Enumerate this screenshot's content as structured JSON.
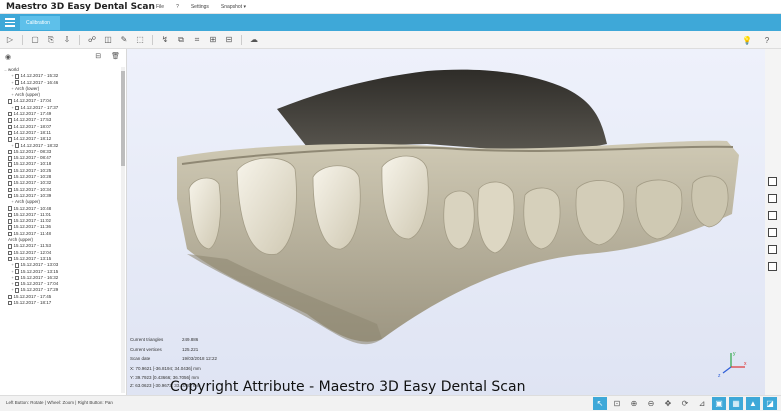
{
  "app": {
    "title": "Maestro 3D Easy Dental Scan"
  },
  "menu": [
    "File",
    "?",
    "Settings",
    "Snapshot"
  ],
  "tab": {
    "label": "Calibration"
  },
  "sidebar": {
    "items": [
      {
        "label": "world",
        "level": 0,
        "exp": "–",
        "doc": false
      },
      {
        "label": "14.12.2017 - 15:32",
        "level": 1,
        "exp": "+",
        "doc": true
      },
      {
        "label": "14.12.2017 - 16:46",
        "level": 1,
        "exp": "+",
        "doc": true
      },
      {
        "label": "Arch (lower)",
        "level": 1,
        "exp": "+",
        "doc": false
      },
      {
        "label": "Arch (upper)",
        "level": 1,
        "exp": "+",
        "doc": false
      },
      {
        "label": "14.12.2017 - 17:04",
        "level": 0,
        "exp": "",
        "doc": true
      },
      {
        "label": "14.12.2017 - 17:37",
        "level": 1,
        "exp": "+",
        "doc": true
      },
      {
        "label": "14.12.2017 - 17:49",
        "level": 0,
        "exp": "",
        "doc": true
      },
      {
        "label": "14.12.2017 - 17:53",
        "level": 0,
        "exp": "",
        "doc": true
      },
      {
        "label": "14.12.2017 - 18:07",
        "level": 0,
        "exp": "",
        "doc": true
      },
      {
        "label": "14.12.2017 - 18:11",
        "level": 0,
        "exp": "",
        "doc": true
      },
      {
        "label": "14.12.2017 - 18:12",
        "level": 0,
        "exp": "",
        "doc": true
      },
      {
        "label": "14.12.2017 - 18:32",
        "level": 1,
        "exp": "+",
        "doc": true
      },
      {
        "label": "15.12.2017 - 08:33",
        "level": 0,
        "exp": "",
        "doc": true
      },
      {
        "label": "15.12.2017 - 08:47",
        "level": 0,
        "exp": "",
        "doc": true
      },
      {
        "label": "15.12.2017 - 10:18",
        "level": 0,
        "exp": "",
        "doc": true
      },
      {
        "label": "15.12.2017 - 10:25",
        "level": 0,
        "exp": "",
        "doc": true
      },
      {
        "label": "15.12.2017 - 10:28",
        "level": 0,
        "exp": "",
        "doc": true
      },
      {
        "label": "15.12.2017 - 10:32",
        "level": 0,
        "exp": "",
        "doc": true
      },
      {
        "label": "15.12.2017 - 10:34",
        "level": 0,
        "exp": "",
        "doc": true
      },
      {
        "label": "15.12.2017 - 10:39",
        "level": 0,
        "exp": "",
        "doc": true
      },
      {
        "label": "Arch (upper)",
        "level": 1,
        "exp": "+",
        "doc": false
      },
      {
        "label": "15.12.2017 - 10:48",
        "level": 0,
        "exp": "",
        "doc": true
      },
      {
        "label": "15.12.2017 - 11:01",
        "level": 0,
        "exp": "",
        "doc": true
      },
      {
        "label": "15.12.2017 - 11:02",
        "level": 0,
        "exp": "",
        "doc": true
      },
      {
        "label": "15.12.2017 - 11:36",
        "level": 0,
        "exp": "",
        "doc": true
      },
      {
        "label": "15.12.2017 - 11:48",
        "level": 0,
        "exp": "",
        "doc": true
      },
      {
        "label": "Arch (upper)",
        "level": 0,
        "exp": "",
        "doc": false
      },
      {
        "label": "15.12.2017 - 11:53",
        "level": 0,
        "exp": "",
        "doc": true
      },
      {
        "label": "15.12.2017 - 12:04",
        "level": 0,
        "exp": "",
        "doc": true
      },
      {
        "label": "15.12.2017 - 13:15",
        "level": 0,
        "exp": "",
        "doc": true
      },
      {
        "label": "15.12.2017 - 13:03",
        "level": 1,
        "exp": "+",
        "doc": true
      },
      {
        "label": "15.12.2017 - 13:15",
        "level": 1,
        "exp": "+",
        "doc": true
      },
      {
        "label": "15.12.2017 - 16:32",
        "level": 1,
        "exp": "+",
        "doc": true
      },
      {
        "label": "15.12.2017 - 17:04",
        "level": 1,
        "exp": "+",
        "doc": true
      },
      {
        "label": "15.12.2017 - 17:29",
        "level": 1,
        "exp": "+",
        "doc": true
      },
      {
        "label": "15.12.2017 - 17:45",
        "level": 0,
        "exp": "",
        "doc": true
      },
      {
        "label": "15.12.2017 - 18:17",
        "level": 0,
        "exp": "",
        "doc": true
      }
    ]
  },
  "info": {
    "triangles_label": "Current triangles",
    "triangles_value": "249.886",
    "vertices_label": "Current vertices",
    "vertices_value": "125.221",
    "date_label": "Scan date",
    "date_value": "19/03/2018 12:22",
    "x": "X: 70.9621 [-36.8194; 34.0436] mm",
    "y": "Y: 39.7923 [0.43666; 36.7056] mm",
    "z": "Z: 63.0623 [-30.9673; 33.1040] mm"
  },
  "status": {
    "hint": "Left Button: Rotate | Wheel: Zoom | Right Button: Pan"
  },
  "copyright": "Copyright Attribute  - Maestro 3D Easy Dental Scan",
  "axes": {
    "x": "x",
    "y": "y",
    "z": "z"
  },
  "colors": {
    "accent": "#3ea8d8",
    "tooth": "#e8e2cf",
    "gum": "#b6ae98",
    "scan_dark": "#3d3b35"
  },
  "toolbar": {
    "icons": [
      "play-icon",
      "save-icon",
      "import-icon",
      "export-icon",
      "tree-icon",
      "cube-view-icon",
      "edit-icon",
      "select-icon",
      "lasso-icon",
      "copy-icon",
      "crop-icon",
      "merge-icon",
      "align-icon",
      "cloud-icon"
    ],
    "right_icons": [
      "bulb-icon",
      "help-icon"
    ]
  },
  "right_tools": [
    "view-front-icon",
    "view-back-icon",
    "view-left-icon",
    "view-right-icon",
    "view-top-icon",
    "view-bottom-icon"
  ],
  "status_tools": [
    {
      "name": "pointer-icon",
      "glyph": "↖",
      "on": true
    },
    {
      "name": "zoom-fit-icon",
      "glyph": "⊡",
      "on": false
    },
    {
      "name": "zoom-in-icon",
      "glyph": "⊕",
      "on": false
    },
    {
      "name": "zoom-out-icon",
      "glyph": "⊖",
      "on": false
    },
    {
      "name": "pan-icon",
      "glyph": "✥",
      "on": false
    },
    {
      "name": "rotate-icon",
      "glyph": "⟳",
      "on": false
    },
    {
      "name": "measure-icon",
      "glyph": "⊿",
      "on": false
    },
    {
      "name": "screenshot-icon",
      "glyph": "▣",
      "on": true
    },
    {
      "name": "wireframe-icon",
      "glyph": "▦",
      "on": true
    },
    {
      "name": "solid-icon",
      "glyph": "▲",
      "on": true
    },
    {
      "name": "texture-icon",
      "glyph": "◪",
      "on": true
    }
  ]
}
